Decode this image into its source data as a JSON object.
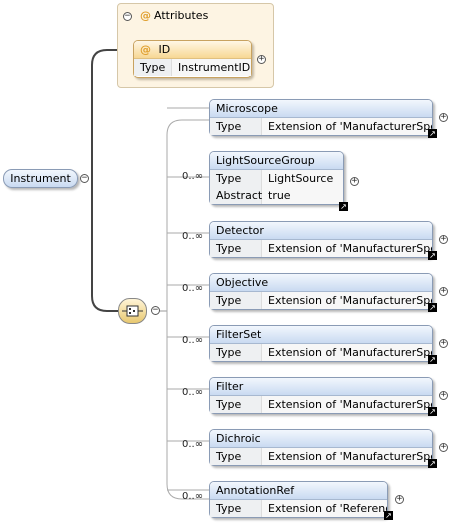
{
  "root": {
    "label": "Instrument"
  },
  "attributes": {
    "title": "Attributes",
    "at_symbol": "@",
    "item": {
      "name": "ID",
      "type_key": "Type",
      "type_value": "InstrumentID"
    }
  },
  "expand": "+",
  "collapse": "−",
  "link_glyph": "↗",
  "sequence_icon": "sequence-icon",
  "children": [
    {
      "name": "Microscope",
      "card": "",
      "rows": [
        {
          "k": "Type",
          "v": "Extension of 'ManufacturerSpec'"
        }
      ]
    },
    {
      "name": "LightSourceGroup",
      "card": "0..∞",
      "rows": [
        {
          "k": "Type",
          "v": "LightSource"
        },
        {
          "k": "Abstract",
          "v": "true"
        }
      ]
    },
    {
      "name": "Detector",
      "card": "0..∞",
      "rows": [
        {
          "k": "Type",
          "v": "Extension of 'ManufacturerSpec'"
        }
      ]
    },
    {
      "name": "Objective",
      "card": "0..∞",
      "rows": [
        {
          "k": "Type",
          "v": "Extension of 'ManufacturerSpec'"
        }
      ]
    },
    {
      "name": "FilterSet",
      "card": "0..∞",
      "rows": [
        {
          "k": "Type",
          "v": "Extension of 'ManufacturerSpec'"
        }
      ]
    },
    {
      "name": "Filter",
      "card": "0..∞",
      "rows": [
        {
          "k": "Type",
          "v": "Extension of 'ManufacturerSpec'"
        }
      ]
    },
    {
      "name": "Dichroic",
      "card": "0..∞",
      "rows": [
        {
          "k": "Type",
          "v": "Extension of 'ManufacturerSpec'"
        }
      ]
    },
    {
      "name": "AnnotationRef",
      "card": "0..∞",
      "rows": [
        {
          "k": "Type",
          "v": "Extension of 'Reference'"
        }
      ]
    }
  ]
}
